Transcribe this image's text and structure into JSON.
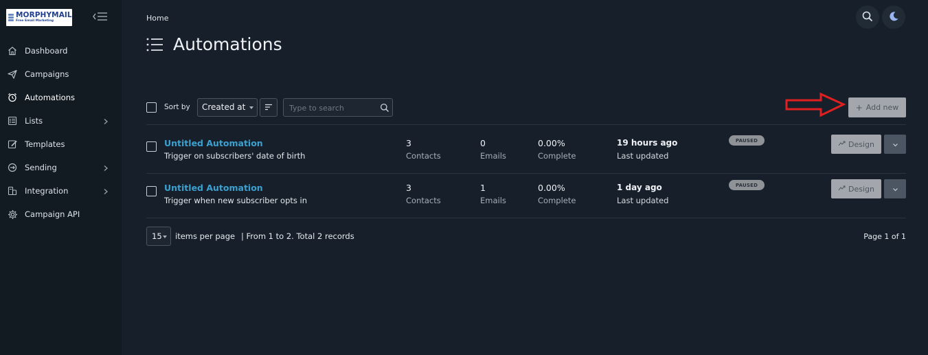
{
  "brand": {
    "title": "MORPHYMAIL",
    "subtitle": "Free Email Marketing"
  },
  "sidebar": {
    "items": [
      {
        "label": "Dashboard",
        "icon": "home-icon",
        "has_submenu": false
      },
      {
        "label": "Campaigns",
        "icon": "paper-plane-icon",
        "has_submenu": false
      },
      {
        "label": "Automations",
        "icon": "alarm-clock-icon",
        "has_submenu": false,
        "active": true
      },
      {
        "label": "Lists",
        "icon": "list-icon",
        "has_submenu": true
      },
      {
        "label": "Templates",
        "icon": "edit-icon",
        "has_submenu": false
      },
      {
        "label": "Sending",
        "icon": "sending-icon",
        "has_submenu": true
      },
      {
        "label": "Integration",
        "icon": "integration-icon",
        "has_submenu": true
      },
      {
        "label": "Campaign API",
        "icon": "gear-icon",
        "has_submenu": false
      }
    ]
  },
  "header": {
    "breadcrumb": "Home",
    "title": "Automations"
  },
  "toolbar": {
    "sort_by_label": "Sort by",
    "sort_value": "Created at",
    "search_placeholder": "Type to search",
    "add_new_label": "Add new"
  },
  "automations": [
    {
      "name": "Untitled Automation",
      "trigger": "Trigger on subscribers' date of birth",
      "contacts": "3",
      "contacts_label": "Contacts",
      "emails": "0",
      "emails_label": "Emails",
      "complete": "0.00%",
      "complete_label": "Complete",
      "updated": "19 hours ago",
      "updated_label": "Last updated",
      "status": "PAUSED",
      "design_label": "Design"
    },
    {
      "name": "Untitled Automation",
      "trigger": "Trigger when new subscriber opts in",
      "contacts": "3",
      "contacts_label": "Contacts",
      "emails": "1",
      "emails_label": "Emails",
      "complete": "0.00%",
      "complete_label": "Complete",
      "updated": "1 day ago",
      "updated_label": "Last updated",
      "status": "PAUSED",
      "design_label": "Design"
    }
  ],
  "pagination": {
    "per_page": "15",
    "per_page_label": "items per page",
    "records_text": "| From 1 to 2. Total 2 records",
    "page_text": "Page 1 of 1"
  },
  "colors": {
    "background": "#17202a",
    "sidebar": "#121a22",
    "link": "#3aa1d1",
    "annotation_arrow": "#e02020",
    "button": "#a3a7ad"
  }
}
